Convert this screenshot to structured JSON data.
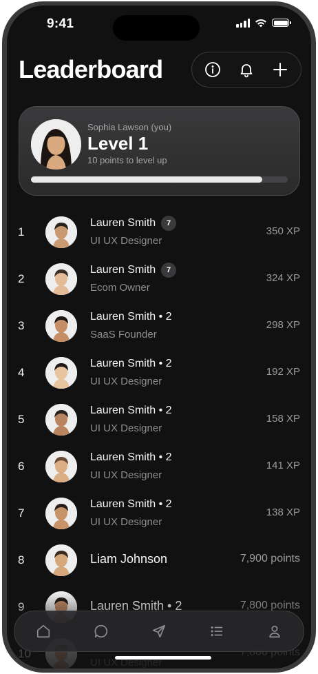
{
  "status": {
    "time": "9:41"
  },
  "header": {
    "title": "Leaderboard"
  },
  "header_icons": [
    "info-icon",
    "bell-icon",
    "plus-icon"
  ],
  "profile": {
    "name": "Sophia Lawson (you)",
    "level": "Level 1",
    "subtitle": "10 points to level up",
    "progress": 0.9
  },
  "leaderboard": [
    {
      "rank": "1",
      "name": "Lauren Smith",
      "badge": "7",
      "subtitle": "UI UX Designer",
      "score": "350 XP"
    },
    {
      "rank": "2",
      "name": "Lauren Smith",
      "badge": "7",
      "subtitle": "Ecom Owner",
      "score": "324 XP"
    },
    {
      "rank": "3",
      "name": "Lauren Smith • 2",
      "subtitle": "SaaS Founder",
      "score": "298 XP"
    },
    {
      "rank": "4",
      "name": "Lauren Smith • 2",
      "subtitle": "UI UX Designer",
      "score": "192 XP"
    },
    {
      "rank": "5",
      "name": "Lauren Smith • 2",
      "subtitle": "UI UX Designer",
      "score": "158 XP"
    },
    {
      "rank": "6",
      "name": "Lauren Smith • 2",
      "subtitle": "UI UX Designer",
      "score": "141 XP"
    },
    {
      "rank": "7",
      "name": "Lauren Smith • 2",
      "subtitle": "UI UX Designer",
      "score": "138 XP"
    },
    {
      "rank": "8",
      "name": "Liam Johnson",
      "subtitle": "",
      "score": "7,900 points"
    },
    {
      "rank": "9",
      "name": "Lauren Smith • 2",
      "subtitle": "",
      "score": "7,800 points"
    },
    {
      "rank": "10",
      "name": "",
      "subtitle": "UI UX Designer",
      "score": "7,800 points"
    }
  ],
  "bottom_nav": [
    "home-icon",
    "chat-icon",
    "send-icon",
    "list-icon",
    "profile-icon"
  ],
  "colors": {
    "background": "#111112",
    "card": "#333335",
    "accent": "#e9e9ea"
  }
}
